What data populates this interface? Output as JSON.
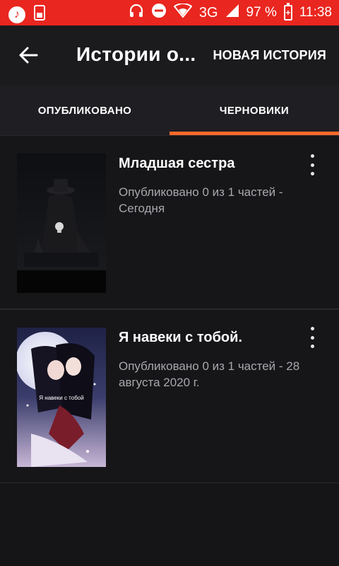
{
  "status_bar": {
    "network": "3G",
    "battery_percent": "97 %",
    "time": "11:38",
    "icons": [
      "music-icon",
      "sim-card-icon",
      "alarm-icon",
      "headphones-icon",
      "do-not-disturb-icon",
      "wifi-icon",
      "signal-icon",
      "battery-charging-icon"
    ]
  },
  "toolbar": {
    "title": "Истории о...",
    "new_story": "НОВАЯ ИСТОРИЯ"
  },
  "tabs": [
    {
      "label": "ОПУБЛИКОВАНО",
      "selected": false
    },
    {
      "label": "ЧЕРНОВИКИ",
      "selected": true
    }
  ],
  "stories": [
    {
      "title": "Младшая сестра",
      "meta": "Опубликовано 0 из 1 частей - Сегодня"
    },
    {
      "title": "Я навеки с тобой.",
      "meta": "Опубликовано 0 из 1 частей - 28 августа 2020 г.",
      "cover_text": "Я навеки с тобой"
    }
  ],
  "colors": {
    "status_bar": "#e9261f",
    "accent": "#ff6a2a",
    "background": "#151417"
  }
}
